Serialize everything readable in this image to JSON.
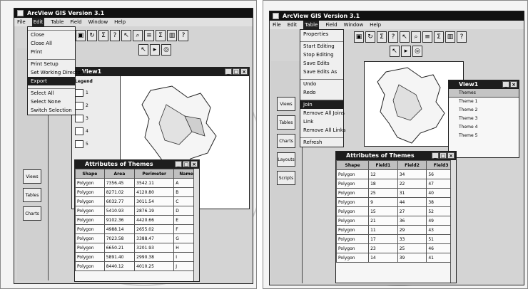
{
  "left": {
    "window_title": "ArcView GIS Version 3.1",
    "menu": [
      "File",
      "Edit",
      "Table",
      "Field",
      "Window",
      "Help"
    ],
    "file_menu_items": [
      "Close",
      "Close All",
      "Print",
      "Print Setup",
      "Set Working Directory",
      "Export",
      "Select All",
      "Select None",
      "Switch Selection"
    ],
    "view_title": "View1",
    "legend_title": "Legend",
    "legend_items": [
      "1",
      "2",
      "3",
      "4",
      "5"
    ],
    "attr_title": "Attributes of Themes",
    "attr_headers": [
      "Shape",
      "Area",
      "Perimeter",
      "Name"
    ],
    "attr_rows": [
      [
        "Polygon",
        "7356.45",
        "3542.11",
        "A"
      ],
      [
        "Polygon",
        "8271.02",
        "4120.80",
        "B"
      ],
      [
        "Polygon",
        "6032.77",
        "3011.54",
        "C"
      ],
      [
        "Polygon",
        "5410.93",
        "2876.19",
        "D"
      ],
      [
        "Polygon",
        "9102.36",
        "4420.66",
        "E"
      ],
      [
        "Polygon",
        "4988.14",
        "2655.02",
        "F"
      ],
      [
        "Polygon",
        "7023.58",
        "3388.47",
        "G"
      ],
      [
        "Polygon",
        "6650.21",
        "3201.93",
        "H"
      ],
      [
        "Polygon",
        "5891.40",
        "2990.38",
        "I"
      ],
      [
        "Polygon",
        "8440.12",
        "4010.25",
        "J"
      ]
    ],
    "side_buttons": [
      "Views",
      "Tables",
      "Charts"
    ]
  },
  "right": {
    "window_title": "ArcView GIS Version 3.1",
    "menu": [
      "File",
      "Edit",
      "Table",
      "Field",
      "Window",
      "Help"
    ],
    "table_menu_items": [
      "Properties",
      "Start Editing",
      "Stop Editing",
      "Save Edits",
      "Save Edits As",
      "Undo",
      "Redo",
      "Join",
      "Remove All Joins",
      "Link",
      "Remove All Links",
      "Refresh"
    ],
    "attr_title": "Attributes of Themes",
    "attr_headers": [
      "Shape",
      "Field1",
      "Field2",
      "Field3"
    ],
    "attr_rows": [
      [
        "Polygon",
        "12",
        "34",
        "56"
      ],
      [
        "Polygon",
        "18",
        "22",
        "47"
      ],
      [
        "Polygon",
        "25",
        "31",
        "40"
      ],
      [
        "Polygon",
        "9",
        "44",
        "38"
      ],
      [
        "Polygon",
        "15",
        "27",
        "52"
      ],
      [
        "Polygon",
        "21",
        "36",
        "49"
      ],
      [
        "Polygon",
        "11",
        "29",
        "43"
      ],
      [
        "Polygon",
        "17",
        "33",
        "51"
      ],
      [
        "Polygon",
        "23",
        "25",
        "46"
      ],
      [
        "Polygon",
        "14",
        "39",
        "41"
      ]
    ],
    "theme_list_title": "View1",
    "theme_list_header": "Themes",
    "theme_list_items": [
      "Theme 1",
      "Theme 2",
      "Theme 3",
      "Theme 4",
      "Theme 5"
    ],
    "side_buttons": [
      "Views",
      "Tables",
      "Charts",
      "Layouts",
      "Scripts"
    ]
  }
}
